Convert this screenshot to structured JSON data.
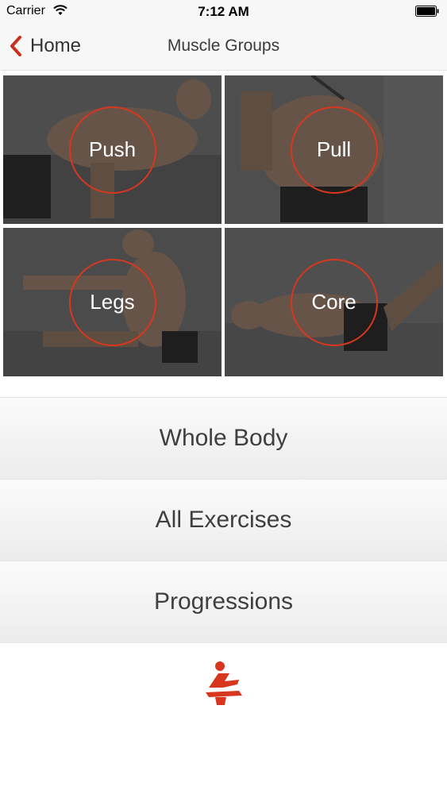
{
  "status_bar": {
    "carrier": "Carrier",
    "time": "7:12 AM"
  },
  "nav": {
    "back_label": "Home",
    "title": "Muscle Groups"
  },
  "tiles": [
    {
      "label": "Push"
    },
    {
      "label": "Pull"
    },
    {
      "label": "Legs"
    },
    {
      "label": "Core"
    }
  ],
  "menu": [
    {
      "label": "Whole Body"
    },
    {
      "label": "All Exercises"
    },
    {
      "label": "Progressions"
    }
  ],
  "colors": {
    "accent": "#d8371f",
    "nav_bg": "#f7f7f7",
    "text": "#3f3f3f"
  },
  "icons": {
    "back": "chevron-left-icon",
    "wifi": "wifi-icon",
    "battery": "battery-icon",
    "logo": "app-logo-icon"
  }
}
